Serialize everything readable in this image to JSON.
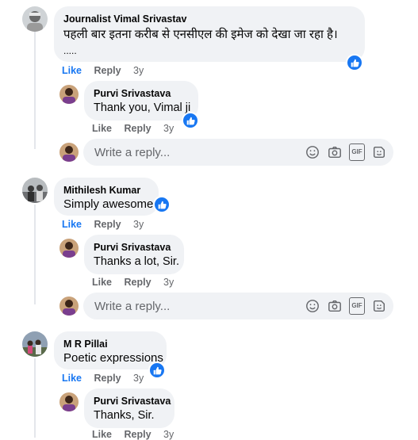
{
  "comments": [
    {
      "author": "Journalist Vimal Srivastav",
      "text_line1": "पहली बार इतना करीब से एनसीएल की इमेज को देखा जा रहा है।",
      "text_line2": ".....",
      "like": "Like",
      "reply": "Reply",
      "time": "3y"
    },
    {
      "author": "Mithilesh Kumar",
      "text": "Simply awesome",
      "like": "Like",
      "reply": "Reply",
      "time": "3y"
    },
    {
      "author": "M R Pillai",
      "text": "Poetic expressions",
      "like": "Like",
      "reply": "Reply",
      "time": "3y"
    }
  ],
  "replies": [
    {
      "author": "Purvi Srivastava",
      "text": "Thank you, Vimal ji",
      "like": "Like",
      "reply": "Reply",
      "time": "3y"
    },
    {
      "author": "Purvi Srivastava",
      "text": "Thanks a lot, Sir.",
      "like": "Like",
      "reply": "Reply",
      "time": "3y"
    },
    {
      "author": "Purvi Srivastava",
      "text": "Thanks, Sir.",
      "like": "Like",
      "reply": "Reply",
      "time": "3y"
    }
  ],
  "reply_box": {
    "placeholder": "Write a reply...",
    "icons": [
      "emoji-icon",
      "camera-icon",
      "gif-icon",
      "sticker-icon"
    ],
    "gif_label": "GIF"
  },
  "colors": {
    "accent": "#1877f2",
    "bubble": "#f0f2f5",
    "secondary_text": "#65676b"
  }
}
